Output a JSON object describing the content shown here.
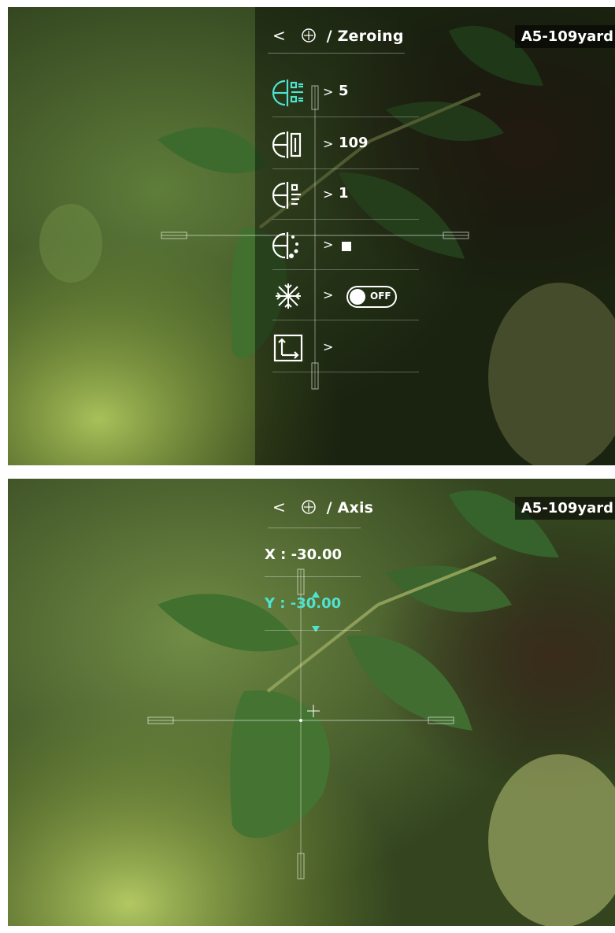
{
  "screen1": {
    "title": "/ Zeroing",
    "back_glyph": "<",
    "badge": "A5-109yard",
    "rows": [
      {
        "icon": "zeroing-profile-icon",
        "value": "5",
        "active": true
      },
      {
        "icon": "distance-icon",
        "value": "109"
      },
      {
        "icon": "reticle-style-icon",
        "value": "1"
      },
      {
        "icon": "reticle-color-icon",
        "value": ""
      },
      {
        "icon": "freeze-icon",
        "toggle": "OFF"
      },
      {
        "icon": "axis-icon",
        "value": ""
      }
    ],
    "arrow": ">"
  },
  "screen2": {
    "title": "/ Axis",
    "back_glyph": "<",
    "badge": "A5-109yard",
    "x_label": "X : -30.00",
    "y_label": "Y : -30.00",
    "accent_color": "#4fe3d0"
  }
}
